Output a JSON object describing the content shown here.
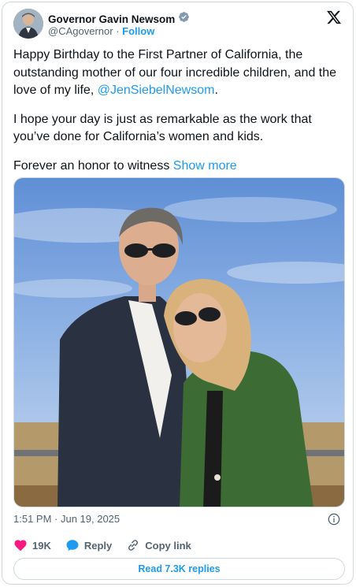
{
  "author": {
    "name": "Governor Gavin Newsom",
    "handle": "@CAgovernor",
    "separator": "·",
    "follow_label": "Follow",
    "verified_icon": "verified-badge-icon"
  },
  "tweet": {
    "paragraph1_text": "Happy Birthday to the First Partner of California, the outstanding mother of our four incredible children, and the love of my life, ",
    "paragraph1_mention": "@JenSiebelNewsom",
    "paragraph1_end": ".",
    "paragraph2": "I hope your day is just as remarkable as the work that you’ve done for California’s women and kids.",
    "paragraph3_text": "Forever an honor to witness ",
    "show_more": "Show more"
  },
  "meta": {
    "timestamp": "1:51 PM · Jun 19, 2025"
  },
  "actions": {
    "likes": "19K",
    "reply": "Reply",
    "copy_link": "Copy link"
  },
  "replies_button": "Read 7.3K replies",
  "colors": {
    "accent": "#1d9bf0",
    "like": "#f91880",
    "muted": "#536471",
    "border": "#cfd9de"
  }
}
